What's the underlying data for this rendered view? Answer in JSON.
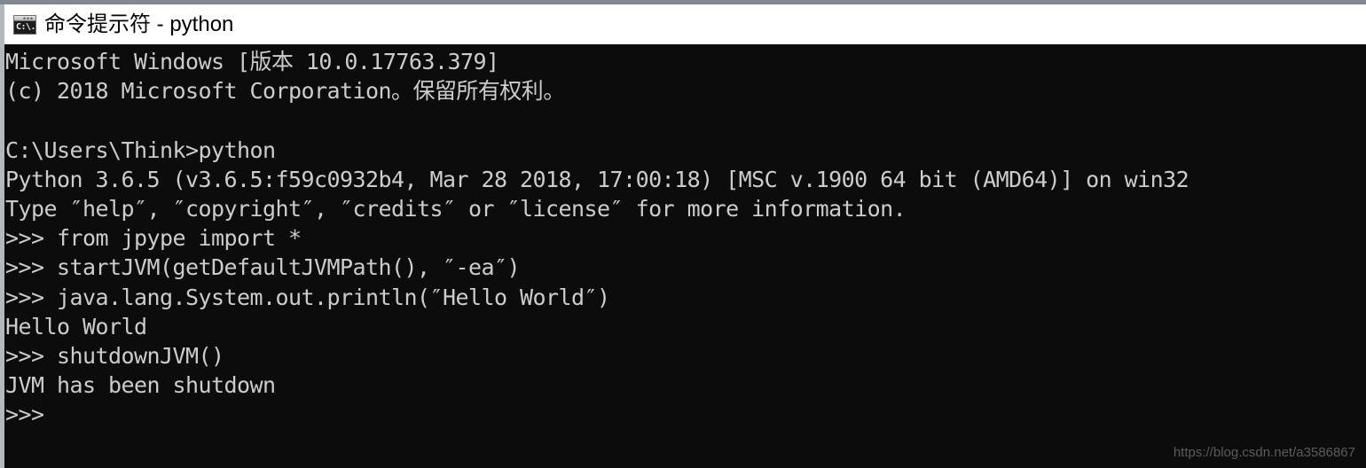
{
  "window": {
    "title": "命令提示符 - python",
    "icon": "command-prompt-icon",
    "icon_glyph": "C:\\.",
    "icon_dots": "▪▪▪",
    "background_color": "#0c0c0c",
    "text_color": "#cccccc",
    "titlebar_color": "#ffffff"
  },
  "console": {
    "lines": [
      "Microsoft Windows [版本 10.0.17763.379]",
      "(c) 2018 Microsoft Corporation。保留所有权利。",
      "",
      "C:\\Users\\Think>python",
      "Python 3.6.5 (v3.6.5:f59c0932b4, Mar 28 2018, 17:00:18) [MSC v.1900 64 bit (AMD64)] on win32",
      "Type ″help″, ″copyright″, ″credits″ or ″license″ for more information.",
      ">>> from jpype import *",
      ">>> startJVM(getDefaultJVMPath(), ″-ea″)",
      ">>> java.lang.System.out.println(″Hello World″)",
      "Hello World",
      ">>> shutdownJVM()",
      "JVM has been shutdown",
      ">>>"
    ]
  },
  "watermark": {
    "text": "https://blog.csdn.net/a3586867"
  }
}
